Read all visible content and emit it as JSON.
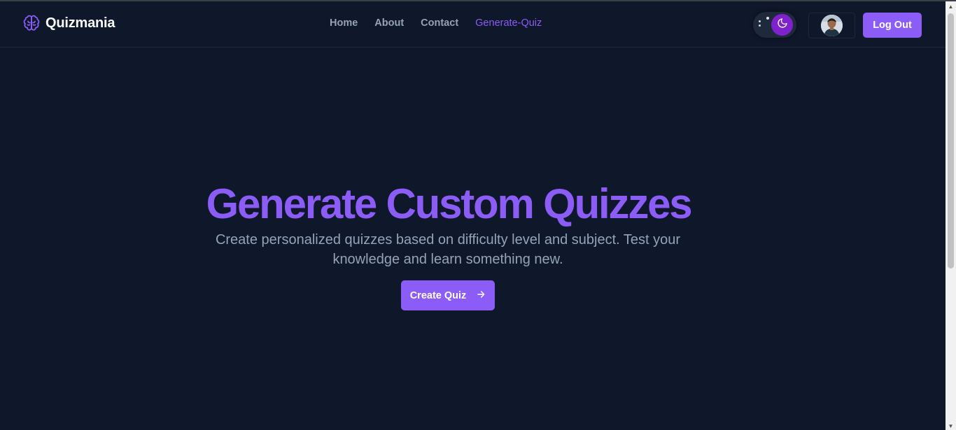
{
  "brand": {
    "name": "Quizmania",
    "logo_icon": "brain-icon"
  },
  "nav": {
    "links": [
      {
        "label": "Home",
        "active": false
      },
      {
        "label": "About",
        "active": false
      },
      {
        "label": "Contact",
        "active": false
      },
      {
        "label": "Generate-Quiz",
        "active": true
      }
    ]
  },
  "theme_toggle": {
    "mode": "dark",
    "icon": "moon-icon"
  },
  "user": {
    "avatar_icon": "user-avatar"
  },
  "actions": {
    "logout_label": "Log Out"
  },
  "hero": {
    "title": "Generate Custom Quizzes",
    "subtitle": "Create personalized quizzes based on difficulty level and subject. Test your knowledge and learn something new.",
    "cta_label": "Create Quiz",
    "cta_icon": "arrow-right-icon"
  },
  "colors": {
    "background": "#0f172a",
    "accent": "#8b5cf6",
    "text_muted": "#94a3b8",
    "toggle_knob": "#7e22ce"
  }
}
